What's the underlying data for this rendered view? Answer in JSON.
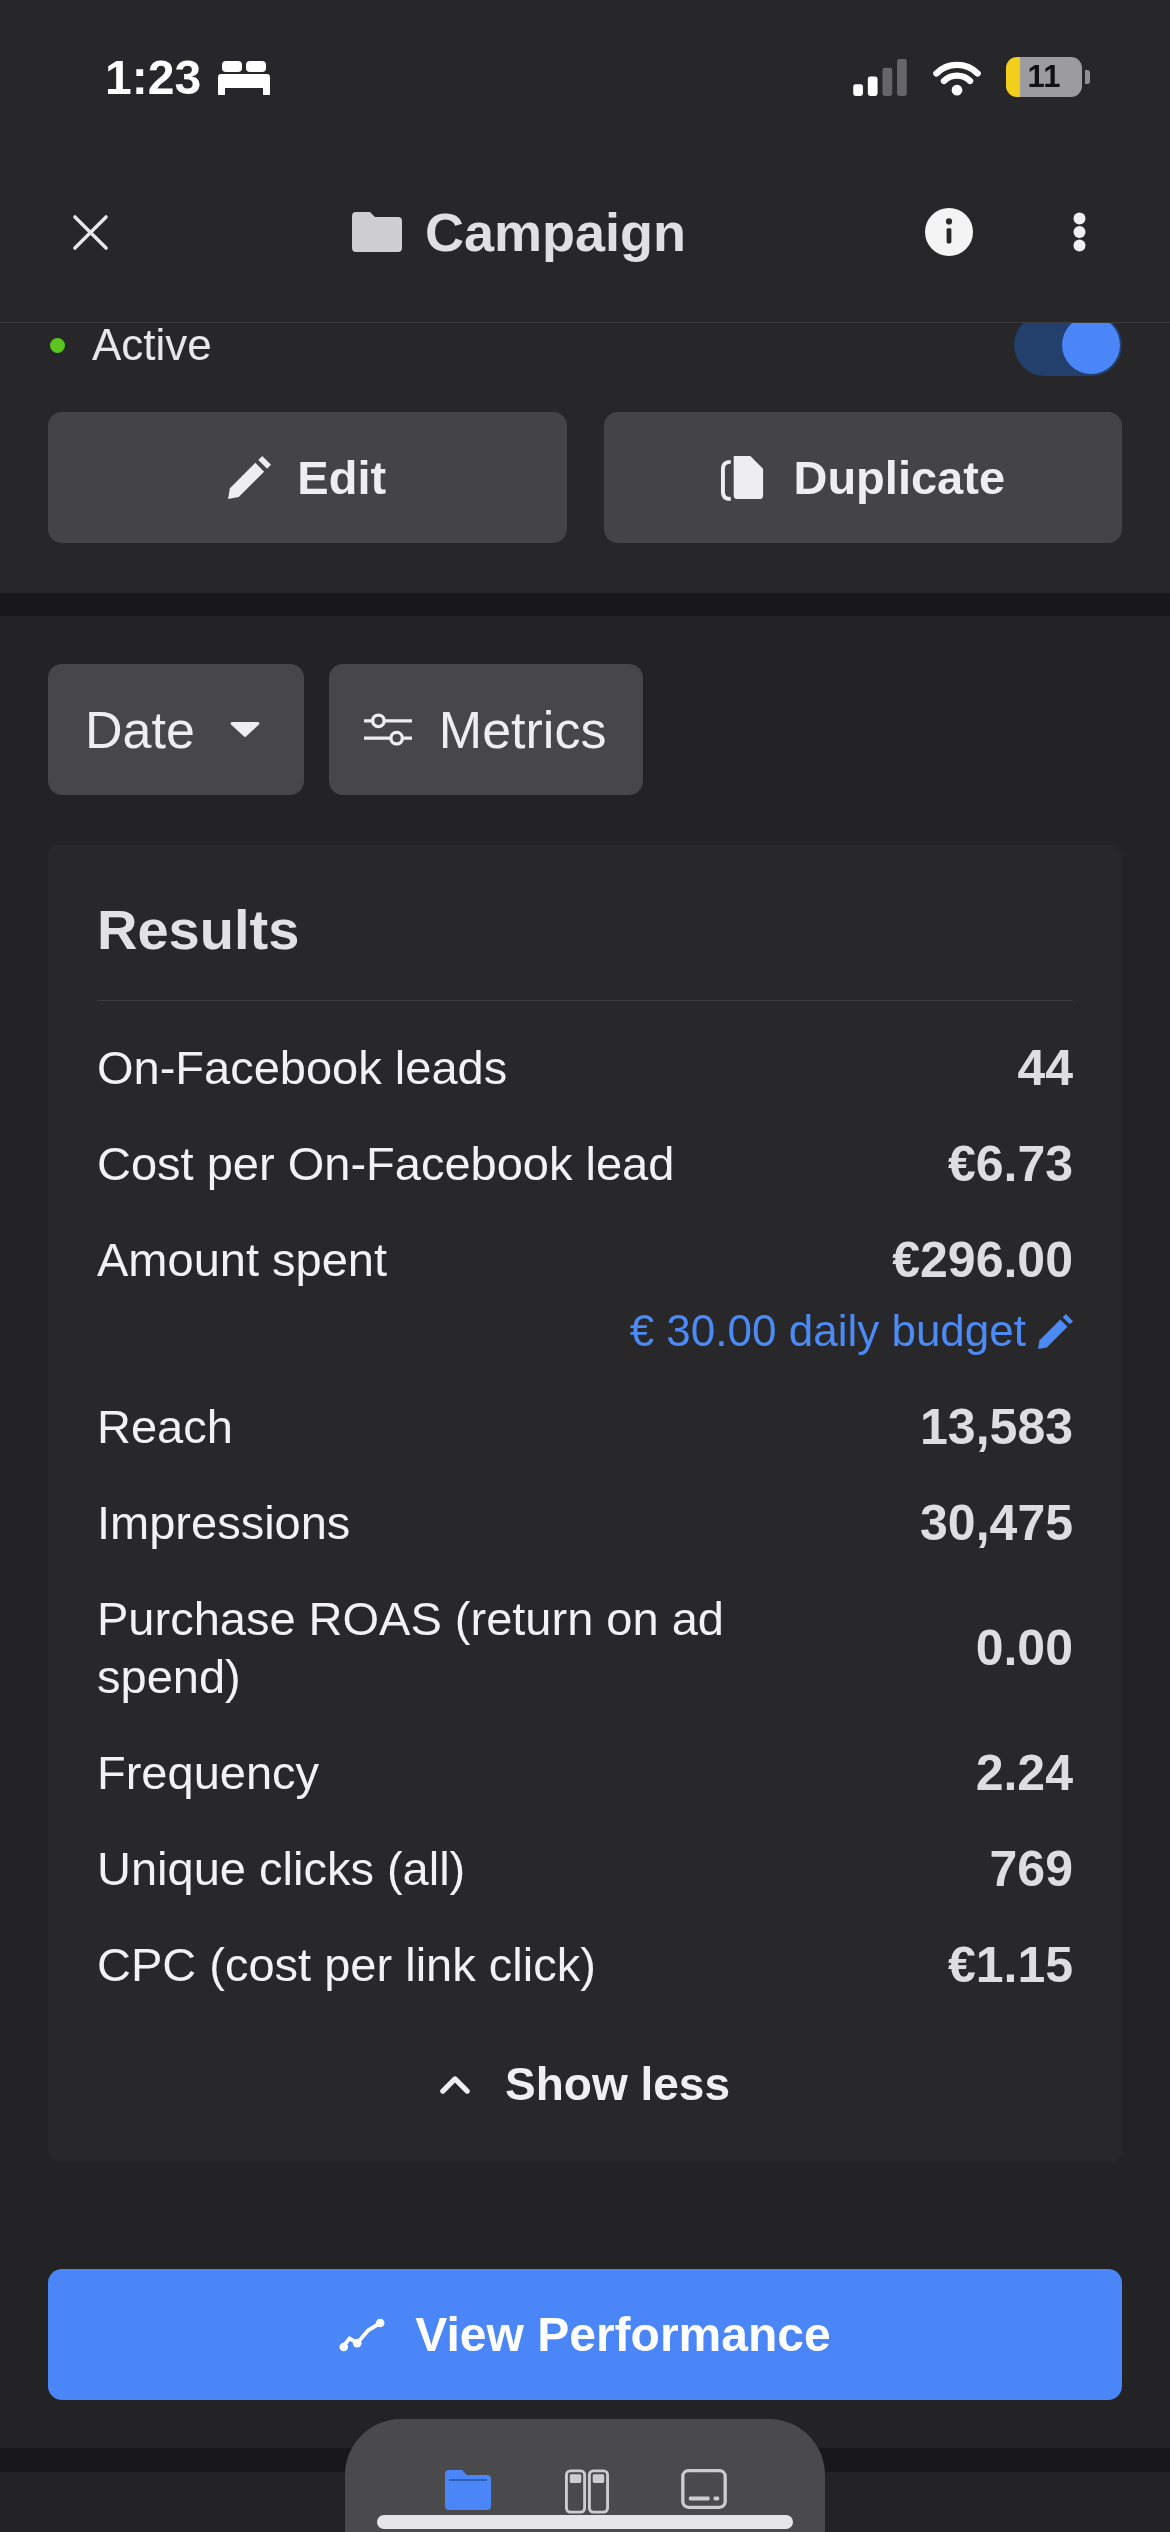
{
  "status_bar": {
    "time": "1:23",
    "battery": "11"
  },
  "header": {
    "title": "Campaign"
  },
  "campaign_status": {
    "label": "Active",
    "on": true
  },
  "actions": [
    {
      "kind": "edit",
      "label": "Edit"
    },
    {
      "kind": "duplicate",
      "label": "Duplicate"
    }
  ],
  "filters": [
    {
      "kind": "dropdown",
      "label": "Date"
    },
    {
      "kind": "settings",
      "label": "Metrics"
    }
  ],
  "results": {
    "title": "Results",
    "rows": [
      {
        "label": "On-Facebook leads",
        "value": "44"
      },
      {
        "label": "Cost per On-Facebook lead",
        "value": "€6.73"
      },
      {
        "label": "Amount spent",
        "value": "€296.00",
        "note": "€ 30.00 daily budget"
      },
      {
        "label": "Reach",
        "value": "13,583"
      },
      {
        "label": "Impressions",
        "value": "30,475"
      },
      {
        "label": "Purchase ROAS (return on ad spend)",
        "value": "0.00"
      },
      {
        "label": "Frequency",
        "value": "2.24"
      },
      {
        "label": "Unique clicks (all)",
        "value": "769"
      },
      {
        "label": "CPC (cost per link click)",
        "value": "€1.15"
      }
    ],
    "toggle": {
      "label": "Show less",
      "expanded": true
    }
  },
  "primary_button": {
    "label": "View Performance"
  },
  "dock": [
    {
      "kind": "folder",
      "selected": true
    },
    {
      "kind": "columns",
      "selected": false
    },
    {
      "kind": "tablet",
      "selected": false
    }
  ]
}
